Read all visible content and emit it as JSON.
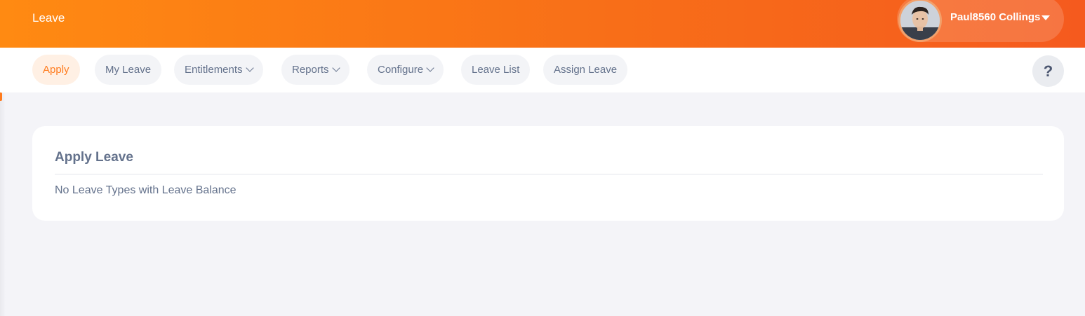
{
  "header": {
    "title": "Leave",
    "user": {
      "name": "Paul8560 Collings"
    }
  },
  "nav": {
    "items": [
      {
        "label": "Apply",
        "active": true,
        "has_dropdown": false
      },
      {
        "label": "My Leave",
        "active": false,
        "has_dropdown": false
      },
      {
        "label": "Entitlements",
        "active": false,
        "has_dropdown": true
      },
      {
        "label": "Reports",
        "active": false,
        "has_dropdown": true
      },
      {
        "label": "Configure",
        "active": false,
        "has_dropdown": true
      },
      {
        "label": "Leave List",
        "active": false,
        "has_dropdown": false
      },
      {
        "label": "Assign Leave",
        "active": false,
        "has_dropdown": false
      }
    ],
    "help_label": "?"
  },
  "card": {
    "title": "Apply Leave",
    "message": "No Leave Types with Leave Balance"
  },
  "colors": {
    "brand_start": "#ff8a12",
    "brand_end": "#f55a1e",
    "accent": "#ff7b1d",
    "text": "#64728c",
    "background": "#f4f4f8"
  },
  "icons": {
    "user_menu": "caret-down-icon",
    "dropdown": "chevron-down-icon",
    "help": "help-icon"
  }
}
